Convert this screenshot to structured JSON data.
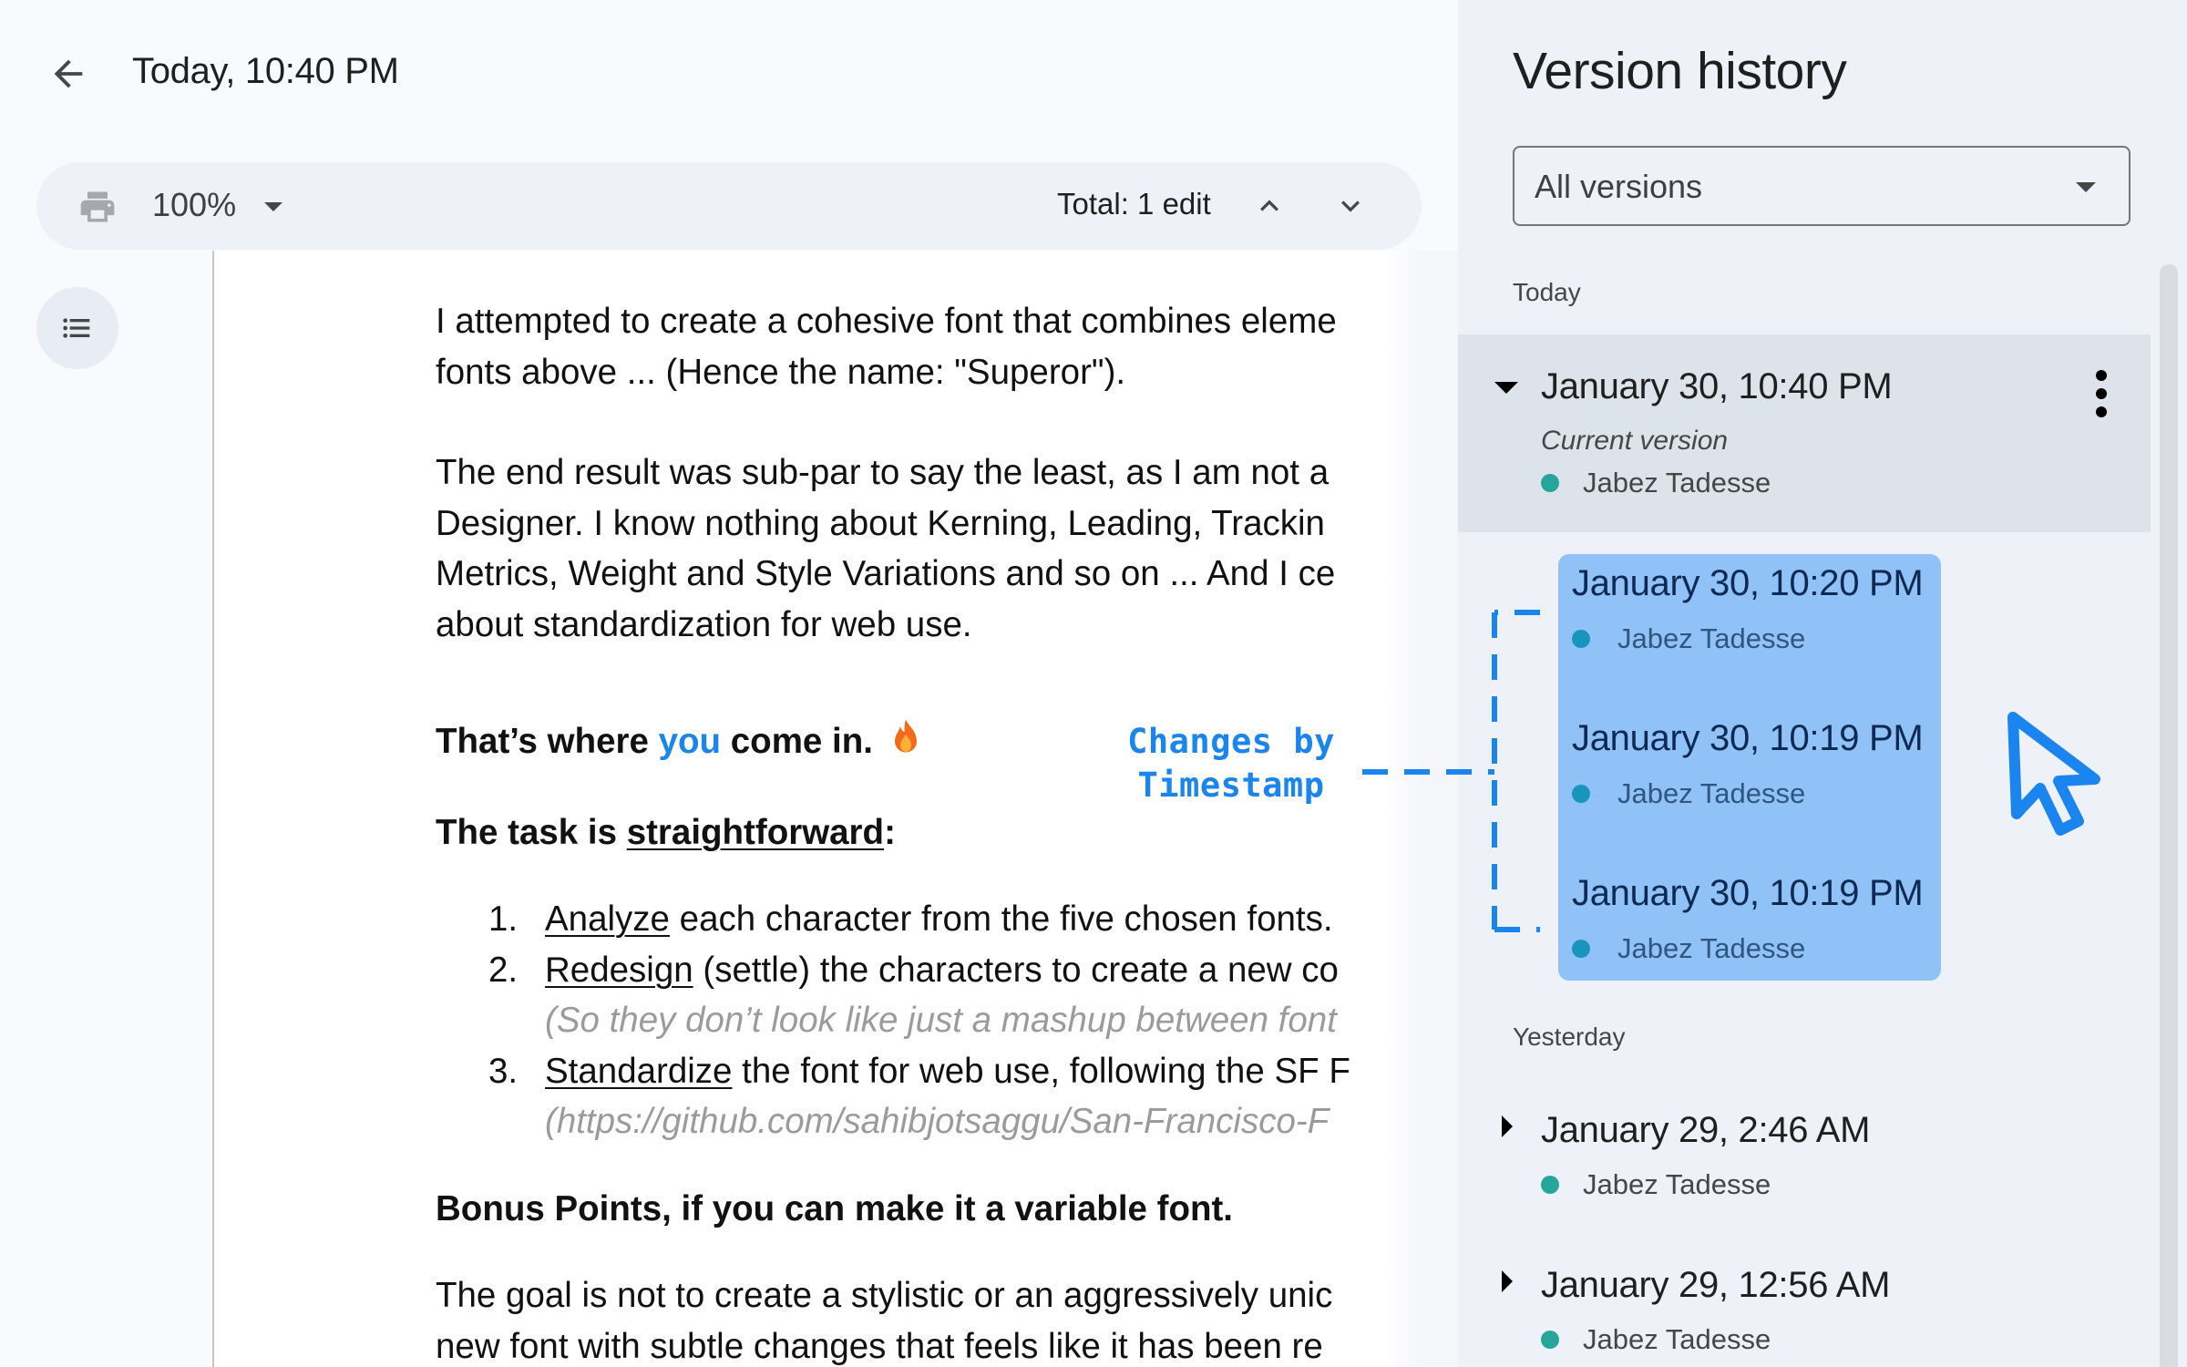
{
  "header": {
    "title": "Today, 10:40 PM",
    "back_icon": "arrow-left-icon"
  },
  "toolbar": {
    "print_icon": "printer-icon",
    "zoom": "100%",
    "edit_count": "Total: 1 edit",
    "prev_icon": "chevron-up-icon",
    "next_icon": "chevron-down-icon"
  },
  "outline": {
    "icon": "list-bulleted-icon"
  },
  "document": {
    "para1": [
      "I attempted to create a cohesive font that combines eleme",
      "fonts above ...  (Hence the name: \"Superor\")."
    ],
    "para2": [
      "The end result was sub-par to say the least, as I am not a",
      "Designer. I know nothing about Kerning, Leading, Trackin",
      "Metrics, Weight and Style Variations and so on ... And I ce",
      "about standardization for web use."
    ],
    "callout": {
      "before": "That’s where ",
      "accent": "you",
      "after": " come in.",
      "emoji": "fire-icon",
      "accent_color": "#1a85ee"
    },
    "task": {
      "before": "The task is ",
      "underlined": "straightforward",
      "after": ":"
    },
    "list": [
      {
        "num": "1.",
        "keyword": "Analyze",
        "rest": " each character from the five chosen fonts."
      },
      {
        "num": "2.",
        "keyword": "Redesign",
        "rest": " (settle) the characters to create a new co",
        "note": "(So they don’t look like just a mashup between font"
      },
      {
        "num": "3.",
        "keyword": "Standardize",
        "rest": " the font for web use, following the SF F",
        "note": "(https://github.com/sahibjotsaggu/San-Francisco-F"
      }
    ],
    "bonus": "Bonus Points, if you can make it a variable font.",
    "para3": [
      "The goal is not to create a stylistic or an aggressively unic",
      "new font with subtle changes that feels like it has been re"
    ]
  },
  "annotation": {
    "line1": "Changes by",
    "line2": "Timestamp",
    "color": "#1a85ee"
  },
  "panel": {
    "title": "Version history",
    "filter": {
      "value": "All versions"
    },
    "sections": [
      {
        "label": "Today",
        "current": {
          "date": "January 30, 10:40 PM",
          "subtitle": "Current version",
          "author": "Jabez Tadesse",
          "expanded": true
        },
        "highlighted": [
          {
            "date": "January 30, 10:20 PM",
            "author": "Jabez Tadesse"
          },
          {
            "date": "January 30, 10:19 PM",
            "author": "Jabez Tadesse"
          },
          {
            "date": "January 30, 10:19 PM",
            "author": "Jabez Tadesse"
          }
        ]
      },
      {
        "label": "Yesterday",
        "items": [
          {
            "date": "January 29, 2:46 AM",
            "author": "Jabez Tadesse",
            "expanded": false
          },
          {
            "date": "January 29, 12:56 AM",
            "author": "Jabez Tadesse",
            "expanded": false
          }
        ]
      }
    ],
    "author_color": "#26a69a",
    "highlight_color": "#90c2f7"
  },
  "cursor": {
    "icon": "mouse-pointer-icon"
  }
}
